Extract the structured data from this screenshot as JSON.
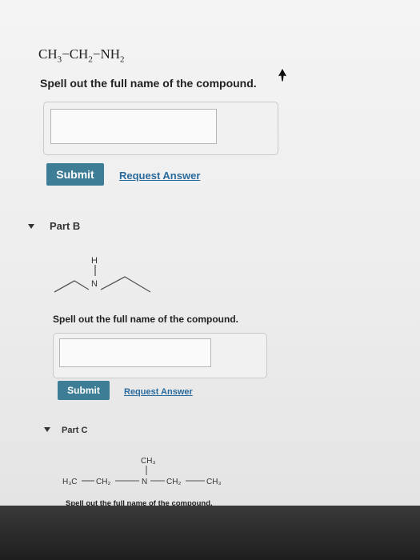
{
  "part_a": {
    "formula": {
      "ch": "CH",
      "ch_sub": "3",
      "dash1": "−",
      "ch2": "CH",
      "ch2_sub": "2",
      "dash2": "−",
      "nh": "NH",
      "nh_sub": "2"
    },
    "prompt": "Spell out the full name of the compound.",
    "answer_value": "",
    "submit_label": "Submit",
    "request_label": "Request Answer"
  },
  "part_b": {
    "label": "Part B",
    "structure": {
      "h_label": "H",
      "n_label": "N"
    },
    "prompt": "Spell out the full name of the compound.",
    "answer_value": "",
    "submit_label": "Submit",
    "request_label": "Request Answer"
  },
  "part_c": {
    "label": "Part C",
    "structure": {
      "top_group": "CH₃",
      "chain": [
        "H₃C",
        "CH₂",
        "N",
        "CH₂",
        "CH₃"
      ]
    },
    "prompt": "Spell out the full name of the compound."
  },
  "colors": {
    "submit_button": "#3d7d96",
    "link": "#2a6b9e",
    "bottom_bar": "#1e1e1e"
  },
  "icons": [
    "cursor-arrow-icon",
    "caret-down-icon"
  ]
}
